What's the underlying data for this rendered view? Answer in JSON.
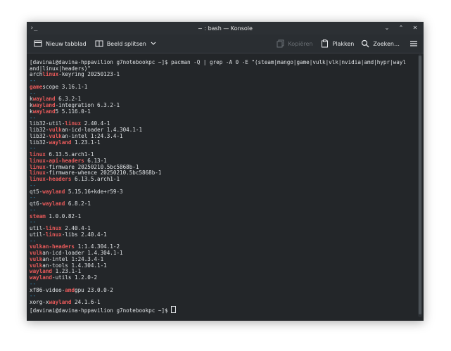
{
  "window": {
    "title": "~ : bash — Konsole"
  },
  "toolbar": {
    "new_tab": "Nieuw tabblad",
    "split_view": "Beeld splitsen",
    "copy": "Kopiëren",
    "paste": "Plakken",
    "search": "Zoeken…"
  },
  "terminal": {
    "command_line_1": "[davinai@davina-hppavilion g7notebookpc ~]$ pacman -Q | grep -A 0 -E \"(steam|mango|game|vulk|vlk|nvidia|amd|hypr|wayl",
    "command_line_2": "and|linux|headers)\"",
    "lines": [
      {
        "a": "arch",
        "h": "linux",
        "b": "-keyring 20250123-1"
      },
      {
        "sep": "--"
      },
      {
        "a": "",
        "h": "game",
        "b": "scope 3.16.1-1"
      },
      {
        "sep": "--"
      },
      {
        "a": "k",
        "h": "wayland",
        "b": " 6.3.2-1"
      },
      {
        "a": "k",
        "h": "wayland",
        "b": "-integration 6.3.2-1"
      },
      {
        "a": "k",
        "h": "wayland",
        "b": "5 5.116.0-1"
      },
      {
        "sep": "--"
      },
      {
        "a": "lib32-util-",
        "h": "linux",
        "b": " 2.40.4-1"
      },
      {
        "a": "lib32-",
        "h": "vulk",
        "b": "an-icd-loader 1.4.304.1-1"
      },
      {
        "a": "lib32-",
        "h": "vulk",
        "b": "an-intel 1:24.3.4-1"
      },
      {
        "a": "lib32-",
        "h": "wayland",
        "b": " 1.23.1-1"
      },
      {
        "sep": "--"
      },
      {
        "a": "",
        "h": "linux",
        "b": " 6.13.5.arch1-1"
      },
      {
        "a": "",
        "h": "linux-api-headers",
        "b": " 6.13-1"
      },
      {
        "a": "",
        "h": "linux",
        "b": "-firmware 20250210.5bc5868b-1"
      },
      {
        "a": "",
        "h": "linux",
        "b": "-firmware-whence 20250210.5bc5868b-1"
      },
      {
        "a": "",
        "h": "linux-headers",
        "b": " 6.13.5.arch1-1"
      },
      {
        "sep": "--"
      },
      {
        "a": "qt5-",
        "h": "wayland",
        "b": " 5.15.16+kde+r59-3"
      },
      {
        "sep": "--"
      },
      {
        "a": "qt6-",
        "h": "wayland",
        "b": " 6.8.2-1"
      },
      {
        "sep": "--"
      },
      {
        "a": "",
        "h": "steam",
        "b": " 1.0.0.82-1"
      },
      {
        "sep": "--"
      },
      {
        "a": "util-",
        "h": "linux",
        "b": " 2.40.4-1"
      },
      {
        "a": "util-",
        "h": "linux",
        "b": "-libs 2.40.4-1"
      },
      {
        "sep": "--"
      },
      {
        "a": "",
        "h": "vulkan-headers",
        "b": " 1:1.4.304.1-2"
      },
      {
        "a": "",
        "h": "vulk",
        "b": "an-icd-loader 1.4.304.1-1"
      },
      {
        "a": "",
        "h": "vulk",
        "b": "an-intel 1:24.3.4-1"
      },
      {
        "a": "",
        "h": "vulk",
        "b": "an-tools 1.4.304.1-1"
      },
      {
        "a": "",
        "h": "wayland",
        "b": " 1.23.1-1"
      },
      {
        "a": "",
        "h": "wayland",
        "b": "-utils 1.2.0-2"
      },
      {
        "sep": "--"
      },
      {
        "a": "xf86-video-",
        "h": "amd",
        "b": "gpu 23.0.0-2"
      },
      {
        "sep": "--"
      },
      {
        "a": "xorg-x",
        "h": "wayland",
        "b": " 24.1.6-1"
      }
    ],
    "prompt": "[davinai@davina-hppavilion g7notebookpc ~]$ "
  },
  "colors": {
    "match": "#e85a5a",
    "separator": "#3aa0d2",
    "background": "#232629",
    "text": "#dfe2e5"
  },
  "icons": [
    "app-icon",
    "new-tab-icon",
    "split-view-icon",
    "chevron-down-icon",
    "copy-icon",
    "paste-icon",
    "search-icon",
    "hamburger-menu-icon",
    "minimize-icon",
    "maximize-icon",
    "close-icon"
  ]
}
